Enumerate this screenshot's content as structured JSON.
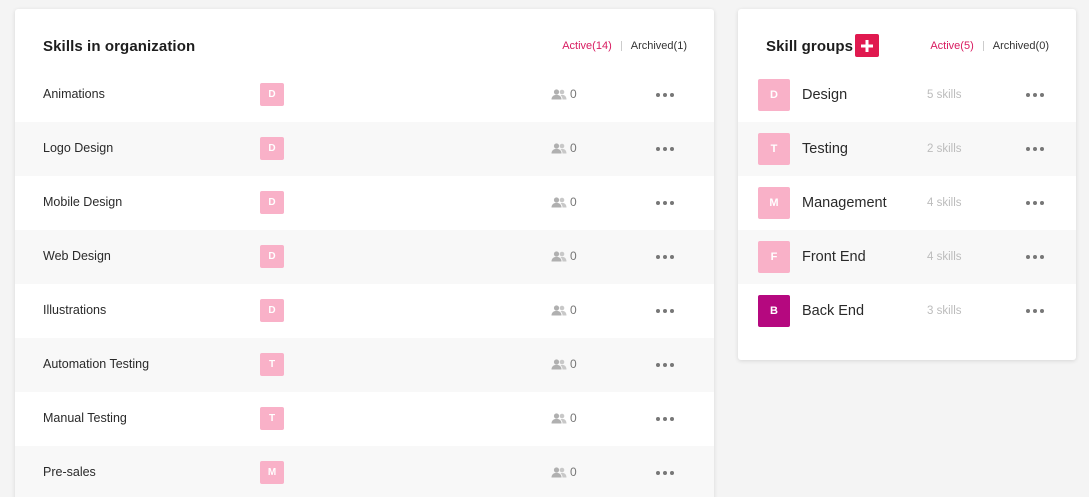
{
  "skills": {
    "title": "Skills in organization",
    "active_label": "Active(14)",
    "archived_label": "Archived(1)",
    "rows": [
      {
        "name": "Animations",
        "badge": "D",
        "members": "0"
      },
      {
        "name": "Logo Design",
        "badge": "D",
        "members": "0"
      },
      {
        "name": "Mobile Design",
        "badge": "D",
        "members": "0"
      },
      {
        "name": "Web Design",
        "badge": "D",
        "members": "0"
      },
      {
        "name": "Illustrations",
        "badge": "D",
        "members": "0"
      },
      {
        "name": "Automation Testing",
        "badge": "T",
        "members": "0"
      },
      {
        "name": "Manual Testing",
        "badge": "T",
        "members": "0"
      },
      {
        "name": "Pre-sales",
        "badge": "M",
        "members": "0"
      }
    ]
  },
  "groups": {
    "title": "Skill groups",
    "active_label": "Active(5)",
    "archived_label": "Archived(0)",
    "rows": [
      {
        "name": "Design",
        "badge": "D",
        "count": "5 skills",
        "badge_color": "#f9b1c8"
      },
      {
        "name": "Testing",
        "badge": "T",
        "count": "2 skills",
        "badge_color": "#f9b1c8"
      },
      {
        "name": "Management",
        "badge": "M",
        "count": "4 skills",
        "badge_color": "#f9b1c8"
      },
      {
        "name": "Front End",
        "badge": "F",
        "count": "4 skills",
        "badge_color": "#f9b1c8"
      },
      {
        "name": "Back End",
        "badge": "B",
        "count": "3 skills",
        "badge_color": "#b5087f"
      }
    ]
  },
  "colors": {
    "accent": "#e0194f",
    "active_filter": "#d81b60",
    "light_badge": "#f9b1c8",
    "dark_badge": "#b5087f"
  },
  "icons": {
    "members": "users-icon",
    "more": "more-horizontal-icon",
    "add": "plus-icon"
  }
}
